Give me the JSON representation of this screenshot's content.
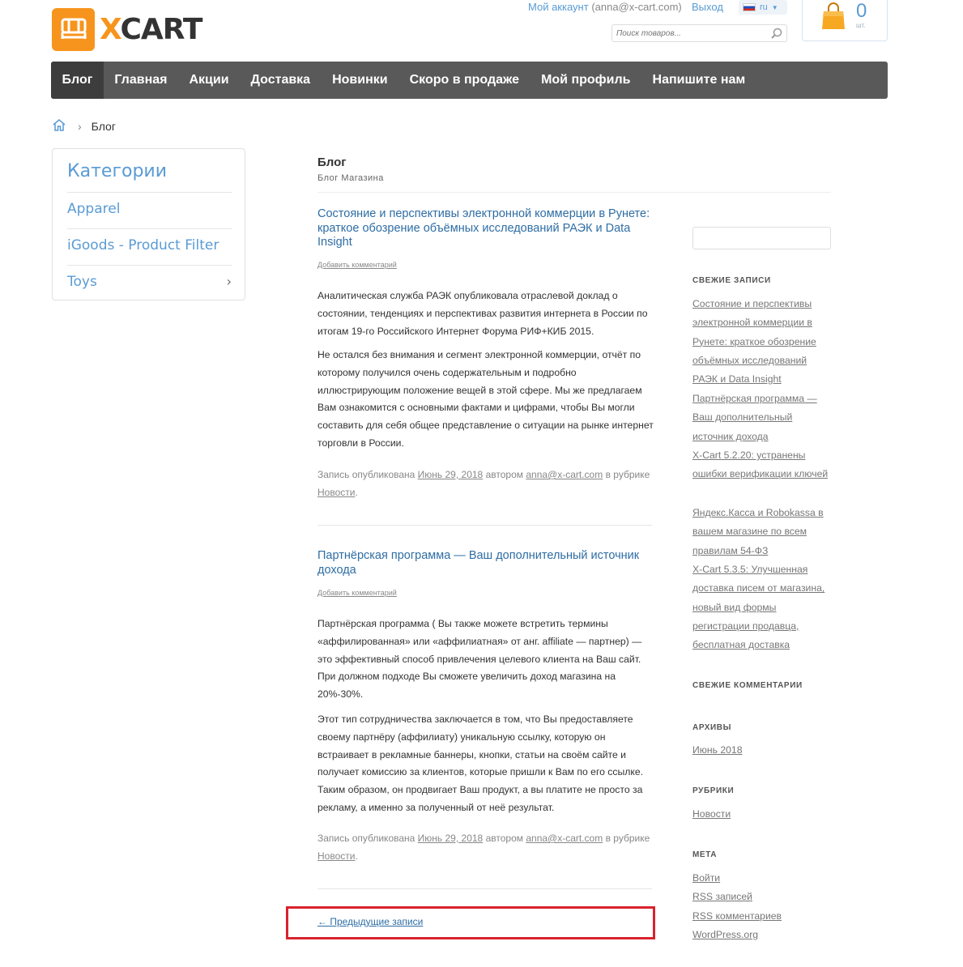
{
  "header": {
    "logo_text_x": "X",
    "logo_text_rest": "CART",
    "account_label": "Мой аккаунт",
    "account_email": "(anna@x-cart.com)",
    "logout": "Выход",
    "lang": "ru",
    "search_placeholder": "Поиск товаров...",
    "cart_count": "0",
    "cart_unit": "шт."
  },
  "nav": [
    "Блог",
    "Главная",
    "Акции",
    "Доставка",
    "Новинки",
    "Скоро в продаже",
    "Мой профиль",
    "Напишите нам"
  ],
  "breadcrumb": {
    "current": "Блог"
  },
  "categories": {
    "title": "Категории",
    "items": [
      "Apparel",
      "iGoods - Product Filter",
      "Toys"
    ]
  },
  "page": {
    "title": "Блог",
    "subtitle": "Блог Магазина"
  },
  "posts": [
    {
      "title": "Состояние и перспективы электронной коммерции в Рунете: краткое обозрение объёмных исследований РАЭК и Data Insight",
      "add_comment": "Добавить комментарий",
      "paragraphs": [
        "Аналитическая служба РАЭК опубликовала отраслевой доклад о состоянии, тенденциях и перспективах развития интернета в России по итогам 19-го Российского Интернет Форума РИФ+КИБ 2015.",
        "Не остался без внимания и сегмент электронной коммерции, отчёт по которому получился очень содержательным и подробно иллюстрирующим положение вещей в этой сфере. Мы же предлагаем Вам ознакомится с основными фактами и цифрами, чтобы Вы могли составить для себя общее представление о ситуации на рынке интернет торговли в России."
      ],
      "meta": {
        "prefix": "Запись опубликована",
        "date": "Июнь 29, 2018",
        "by": "автором",
        "author": "anna@x-cart.com",
        "in": "в рубрике",
        "category": "Новости",
        "end": "."
      }
    },
    {
      "title": "Партнёрская программа — Ваш дополнительный источник дохода",
      "add_comment": "Добавить комментарий",
      "paragraphs": [
        "Партнёрская программа ( Вы также можете встретить термины «аффилированная» или «аффилиатная» от анг. affiliate — партнер) — это эффективный способ привлечения целевого клиента на Ваш сайт. При должном подходе Вы сможете увеличить доход магазина на 20%-30%.",
        "Этот тип сотрудничества заключается в том, что Вы предоставляете своему партнёру (аффилиату) уникальную ссылку, которую он встраивает в рекламные баннеры, кнопки, статьи на своём сайте и получает комиссию за клиентов, которые пришли к Вам по его ссылке. Таким образом, он продвигает Ваш продукт, а вы платите не просто за рекламу, а именно за полученный от неё результат."
      ],
      "meta": {
        "prefix": "Запись опубликована",
        "date": "Июнь 29, 2018",
        "by": "автором",
        "author": "anna@x-cart.com",
        "in": "в рубрике",
        "category": "Новости",
        "end": "."
      }
    }
  ],
  "prev_link": "← Предыдущие записи",
  "sidebar": {
    "recent_posts_title": "СВЕЖИЕ ЗАПИСИ",
    "recent_posts": [
      "Состояние и перспективы электронной коммерции в Рунете: краткое обозрение объёмных исследований РАЭК и Data Insight",
      "Партнёрская программа — Ваш дополнительный источник дохода",
      "X-Cart 5.2.20: устранены ошибки верификации ключей",
      "Яндекс.Касса и Robokassa в вашем магазине по всем правилам 54-ФЗ",
      "X-Cart 5.3.5: Улучшенная доставка писем от магазина, новый вид формы регистрации продавца, бесплатная доставка"
    ],
    "recent_comments_title": "СВЕЖИЕ КОММЕНТАРИИ",
    "archives_title": "АРХИВЫ",
    "archives": [
      "Июнь 2018"
    ],
    "rubrics_title": "РУБРИКИ",
    "rubrics": [
      "Новости"
    ],
    "meta_title": "МЕТА",
    "meta_links": [
      "Войти",
      "RSS записей",
      "RSS комментариев",
      "WordPress.org"
    ]
  }
}
